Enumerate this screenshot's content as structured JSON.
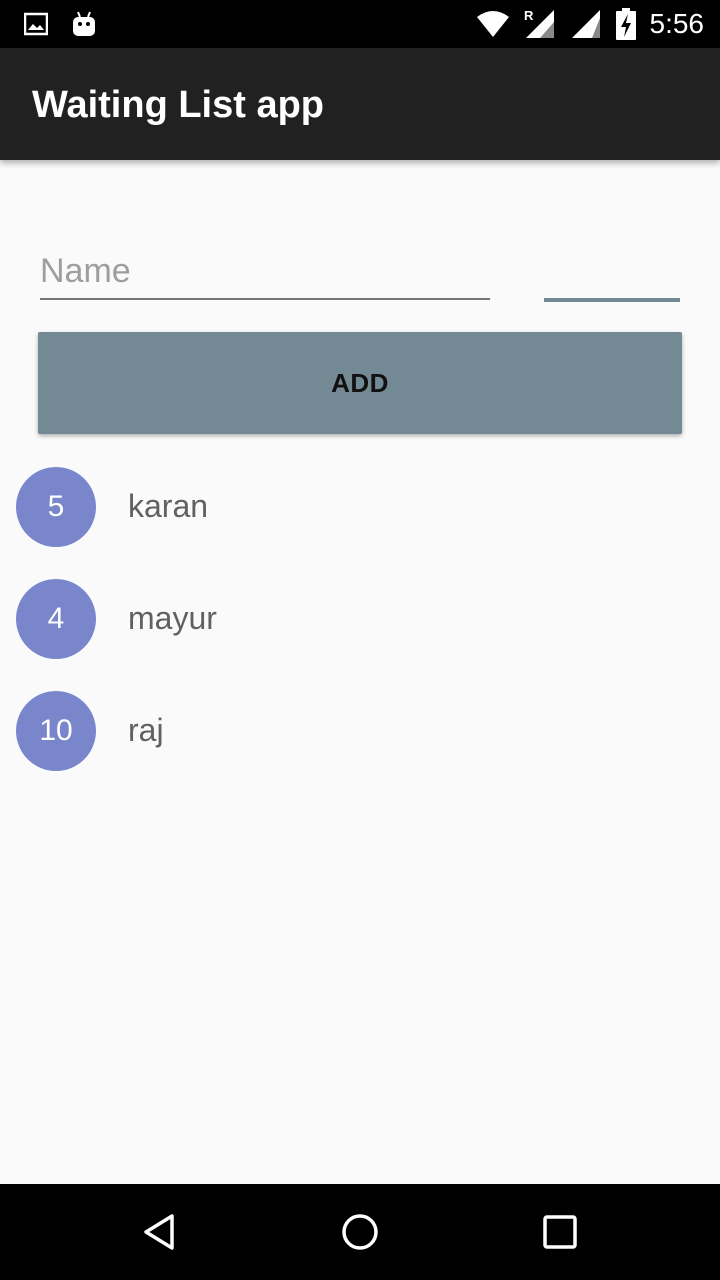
{
  "status_bar": {
    "time": "5:56",
    "icons": [
      "image-notification-icon",
      "android-notification-icon",
      "wifi-icon",
      "signal-roaming-icon",
      "signal-icon",
      "battery-charging-icon"
    ],
    "roaming_label": "R"
  },
  "app_bar": {
    "title": "Waiting List app"
  },
  "form": {
    "name_placeholder": "Name",
    "name_value": "",
    "party_size_value": "",
    "add_label": "ADD"
  },
  "guests": [
    {
      "party_size": "5",
      "name": "karan"
    },
    {
      "party_size": "4",
      "name": "mayur"
    },
    {
      "party_size": "10",
      "name": "raj"
    }
  ],
  "nav_bar": {
    "icons": [
      "back-icon",
      "home-icon",
      "recents-icon"
    ]
  },
  "colors": {
    "app_bar": "#212121",
    "accent": "#738a94",
    "badge": "#7986cb",
    "background": "#fafafa"
  }
}
